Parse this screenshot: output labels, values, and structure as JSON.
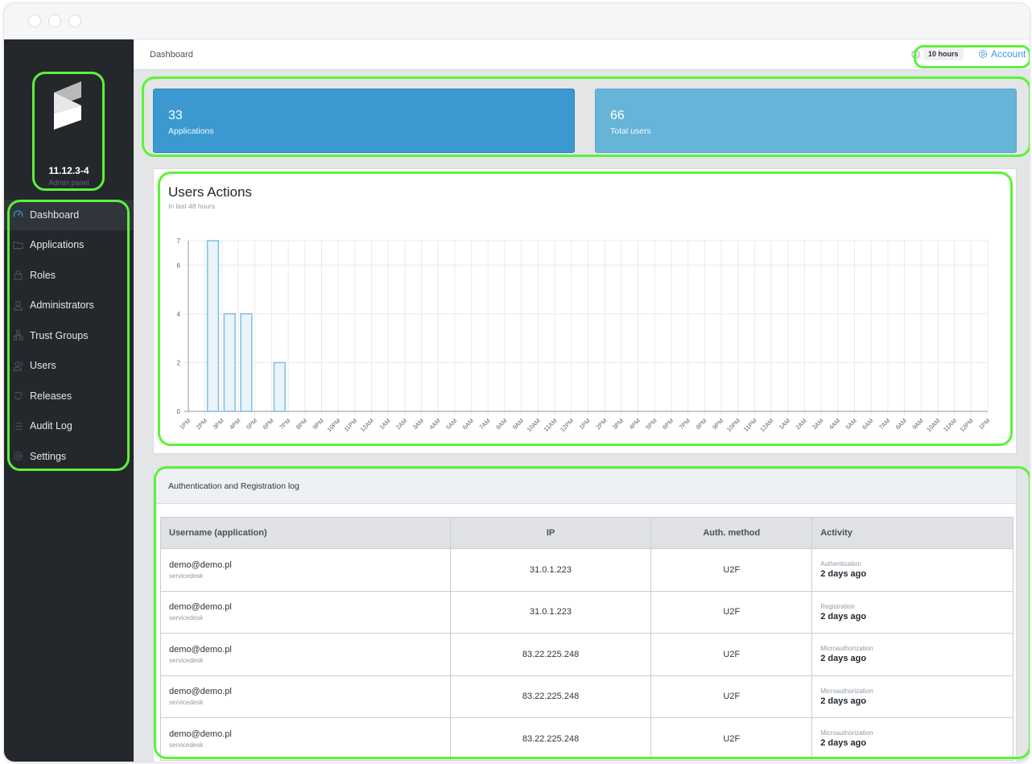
{
  "window": {
    "controls": [
      "close",
      "minimize",
      "maximize"
    ]
  },
  "sidebar": {
    "logo": "logo-icon",
    "version": "11.12.3-4",
    "subtitle": "Admin panel",
    "items": [
      {
        "label": "Dashboard",
        "icon": "speedometer-icon",
        "active": true
      },
      {
        "label": "Applications",
        "icon": "folder-icon",
        "active": false
      },
      {
        "label": "Roles",
        "icon": "lock-icon",
        "active": false
      },
      {
        "label": "Administrators",
        "icon": "user-icon",
        "active": false
      },
      {
        "label": "Trust Groups",
        "icon": "hierarchy-icon",
        "active": false
      },
      {
        "label": "Users",
        "icon": "users-icon",
        "active": false
      },
      {
        "label": "Releases",
        "icon": "refresh-icon",
        "active": false
      },
      {
        "label": "Audit Log",
        "icon": "list-icon",
        "active": false
      },
      {
        "label": "Settings",
        "icon": "gear-icon",
        "active": false
      }
    ]
  },
  "topbar": {
    "breadcrumb": "Dashboard",
    "session_time": "10 hours",
    "account_label": "Account"
  },
  "stats": [
    {
      "value": "33",
      "label": "Applications",
      "color": "#3b99d0"
    },
    {
      "value": "66",
      "label": "Total users",
      "color": "#66b5d8"
    }
  ],
  "chart_panel": {
    "title": "Users Actions",
    "subtitle": "In last 48 hours"
  },
  "chart_data": {
    "type": "bar",
    "title": "Users Actions",
    "subtitle": "In last 48 hours",
    "xlabel": "",
    "ylabel": "",
    "ylim": [
      0,
      7
    ],
    "yticks": [
      0,
      2,
      4,
      6,
      7
    ],
    "grid": true,
    "legend": "none",
    "bar_color": "#7cc0e0",
    "bar_fill": "#eaf4fa",
    "categories": [
      "1PM",
      "2PM",
      "3PM",
      "4PM",
      "5PM",
      "6PM",
      "7PM",
      "8PM",
      "9PM",
      "10PM",
      "11PM",
      "12AM",
      "1AM",
      "2AM",
      "3AM",
      "4AM",
      "5AM",
      "6AM",
      "7AM",
      "8AM",
      "9AM",
      "10AM",
      "11AM",
      "12PM",
      "1PM",
      "2PM",
      "3PM",
      "4PM",
      "5PM",
      "6PM",
      "7PM",
      "8PM",
      "9PM",
      "10PM",
      "11PM",
      "12AM",
      "1AM",
      "2AM",
      "3AM",
      "4AM",
      "5AM",
      "6AM",
      "7AM",
      "8AM",
      "9AM",
      "10AM",
      "11AM",
      "12PM",
      "1PM"
    ],
    "values": [
      0,
      7,
      4,
      4,
      0,
      2,
      0,
      0,
      0,
      0,
      0,
      0,
      0,
      0,
      0,
      0,
      0,
      0,
      0,
      0,
      0,
      0,
      0,
      0,
      0,
      0,
      0,
      0,
      0,
      0,
      0,
      0,
      0,
      0,
      0,
      0,
      0,
      0,
      0,
      0,
      0,
      0,
      0,
      0,
      0,
      0,
      0,
      0,
      0
    ]
  },
  "log": {
    "title": "Authentication and Registration log",
    "columns": [
      "Username (application)",
      "IP",
      "Auth. method",
      "Activity"
    ],
    "rows": [
      {
        "username": "demo@demo.pl",
        "application": "servicedesk",
        "ip": "31.0.1.223",
        "method": "U2F",
        "activity": "Authentication",
        "when": "2 days ago"
      },
      {
        "username": "demo@demo.pl",
        "application": "servicedesk",
        "ip": "31.0.1.223",
        "method": "U2F",
        "activity": "Registration",
        "when": "2 days ago"
      },
      {
        "username": "demo@demo.pl",
        "application": "servicedesk",
        "ip": "83.22.225.248",
        "method": "U2F",
        "activity": "Microauthorization",
        "when": "2 days ago"
      },
      {
        "username": "demo@demo.pl",
        "application": "servicedesk",
        "ip": "83.22.225.248",
        "method": "U2F",
        "activity": "Microauthorization",
        "when": "2 days ago"
      },
      {
        "username": "demo@demo.pl",
        "application": "servicedesk",
        "ip": "83.22.225.248",
        "method": "U2F",
        "activity": "Microauthorization",
        "when": "2 days ago"
      }
    ]
  }
}
